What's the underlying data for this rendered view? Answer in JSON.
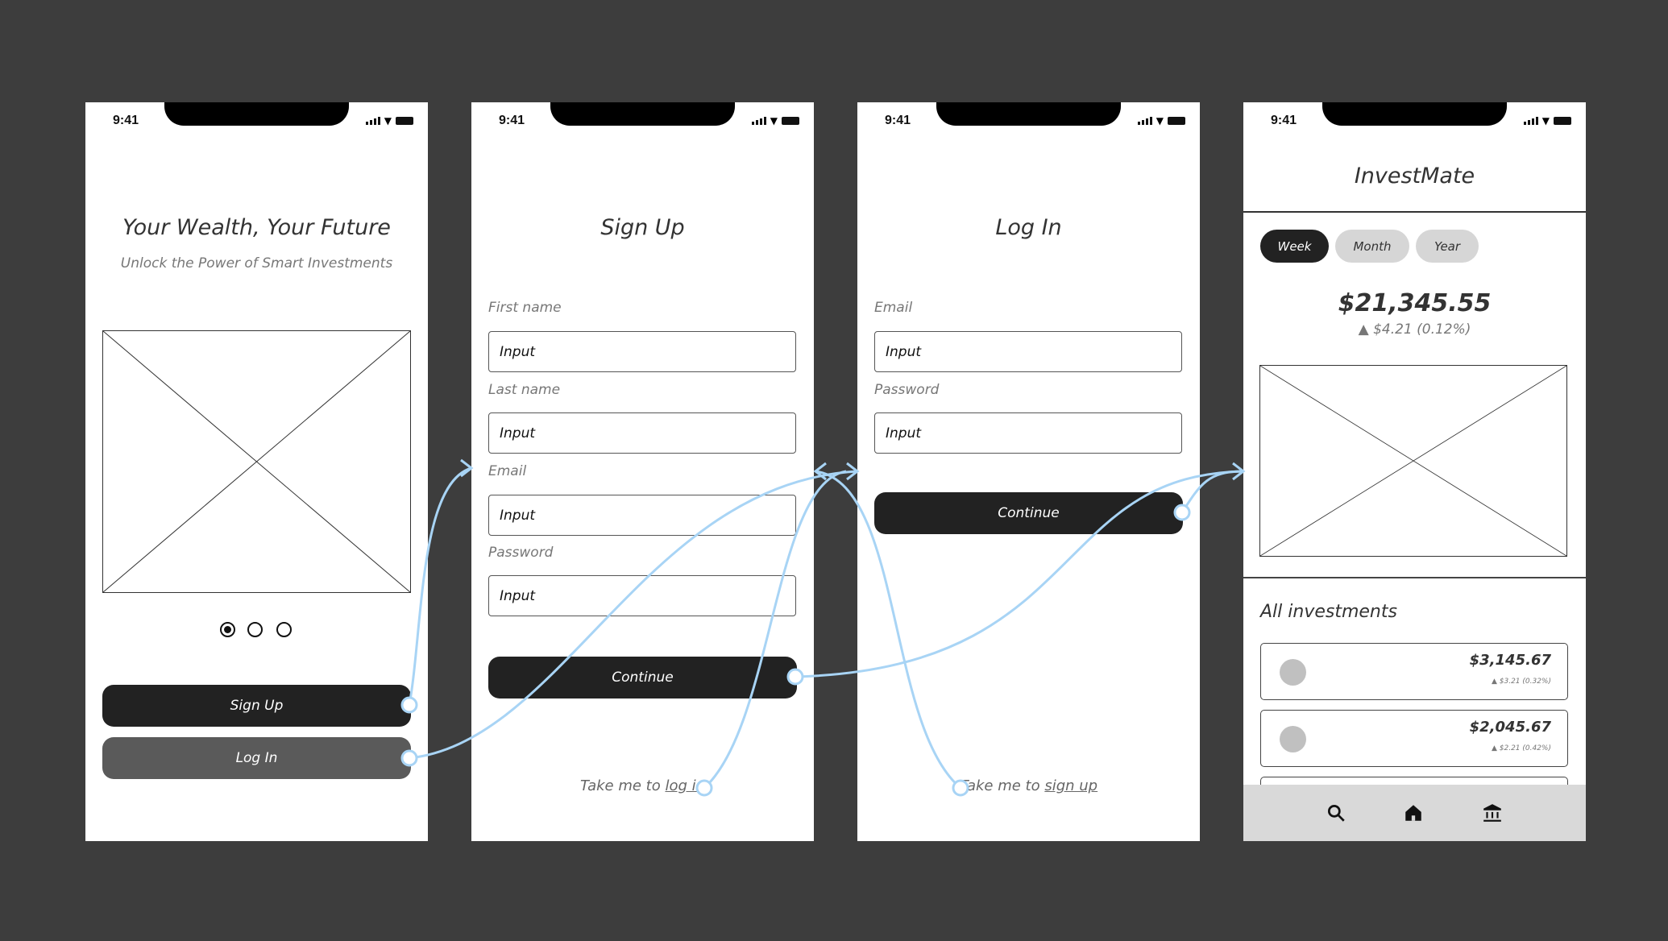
{
  "status_time": "9:41",
  "connector_color": "#a8d4f5",
  "onboarding": {
    "title": "Your Wealth, Your Future",
    "subtitle": "Unlock the Power of Smart Investments",
    "carousel_pages": 3,
    "carousel_active": 1,
    "signup_label": "Sign Up",
    "login_label": "Log In"
  },
  "signup": {
    "title": "Sign Up",
    "fields": [
      {
        "label": "First name",
        "value": "Input"
      },
      {
        "label": "Last name",
        "value": "Input"
      },
      {
        "label": "Email",
        "value": "Input"
      },
      {
        "label": "Password",
        "value": "Input"
      }
    ],
    "continue_label": "Continue",
    "link_prefix": "Take me to ",
    "link_text": "log in"
  },
  "login": {
    "title": "Log In",
    "fields": [
      {
        "label": "Email",
        "value": "Input"
      },
      {
        "label": "Password",
        "value": "Input"
      }
    ],
    "continue_label": "Continue",
    "link_prefix": "Take me to ",
    "link_text": "sign up"
  },
  "dashboard": {
    "title": "InvestMate",
    "periods": [
      {
        "label": "Week",
        "active": true
      },
      {
        "label": "Month",
        "active": false
      },
      {
        "label": "Year",
        "active": false
      }
    ],
    "balance": "$21,345.55",
    "change": "$4.21 (0.12%)",
    "section_title": "All investments",
    "investments": [
      {
        "amount": "$3,145.67",
        "change": "$3.21 (0.32%)"
      },
      {
        "amount": "$2,045.67",
        "change": "$2.21 (0.42%)"
      }
    ],
    "tabs": [
      "search-icon",
      "home-icon",
      "bank-icon"
    ]
  }
}
